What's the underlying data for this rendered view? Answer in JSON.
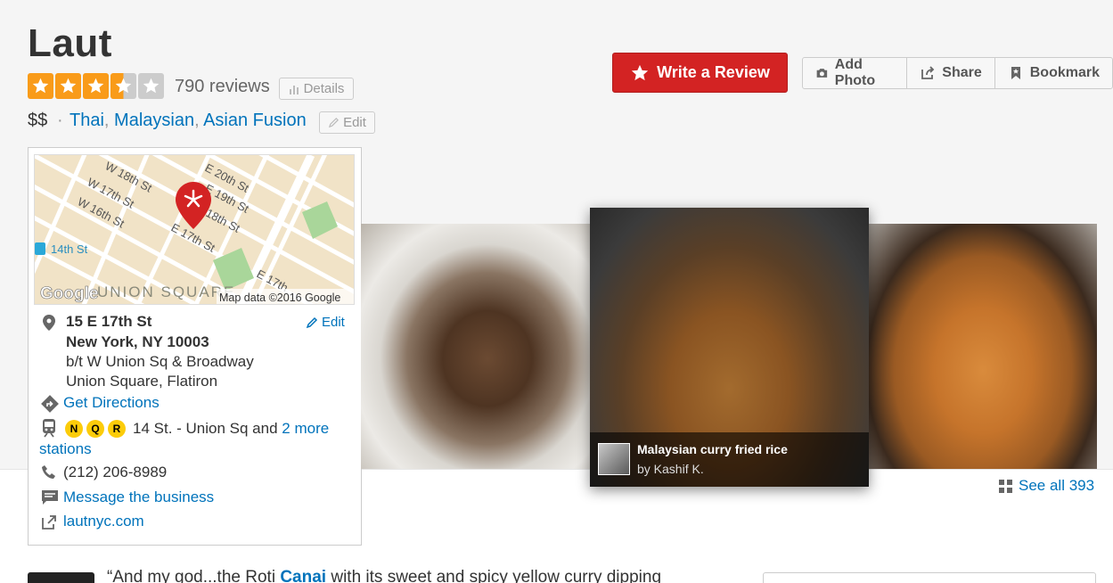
{
  "business": {
    "name": "Laut",
    "rating": 3.5,
    "review_count": "790 reviews",
    "details_label": "Details",
    "price": "$$",
    "separator": "·",
    "categories": [
      "Thai",
      "Malaysian",
      "Asian Fusion"
    ],
    "edit_label": "Edit"
  },
  "actions": {
    "write_review": "Write a Review",
    "add_photo": "Add Photo",
    "share": "Share",
    "bookmark": "Bookmark"
  },
  "map": {
    "streets": [
      "W 18th St",
      "W 17th St",
      "W 16th St",
      "E 20th St",
      "E 19th St",
      "E 18th St",
      "E 17th St",
      "E 17th"
    ],
    "station_label": "14th St",
    "area_label": "UNION SQUARE",
    "logo": "Google",
    "attribution": "Map data ©2016 Google"
  },
  "address": {
    "line1": "15 E 17th St",
    "line2": "New York, NY 10003",
    "cross": "b/t W Union Sq & Broadway",
    "neighborhood": "Union Square, Flatiron",
    "edit_label": "Edit"
  },
  "directions": "Get Directions",
  "transit": {
    "lines": [
      "N",
      "Q",
      "R"
    ],
    "station_text": "14 St. - Union Sq and ",
    "more_link": "2 more",
    "more_link_cont": "stations",
    "line_color": "#fccc0a"
  },
  "phone": "(212) 206-8989",
  "message": "Message the business",
  "website": "lautnyc.com",
  "photos": {
    "featured_caption": "Malaysian curry fried rice",
    "featured_by": "by Kashif K.",
    "see_all": "See all 393"
  },
  "review_snippet": {
    "prefix": "“And my god...the Roti ",
    "highlight": "Canai",
    "suffix": " with its sweet and spicy yellow curry dipping"
  },
  "colors": {
    "brand_red": "#d32323",
    "star_orange": "#f99b19",
    "link_blue": "#0073bb"
  }
}
